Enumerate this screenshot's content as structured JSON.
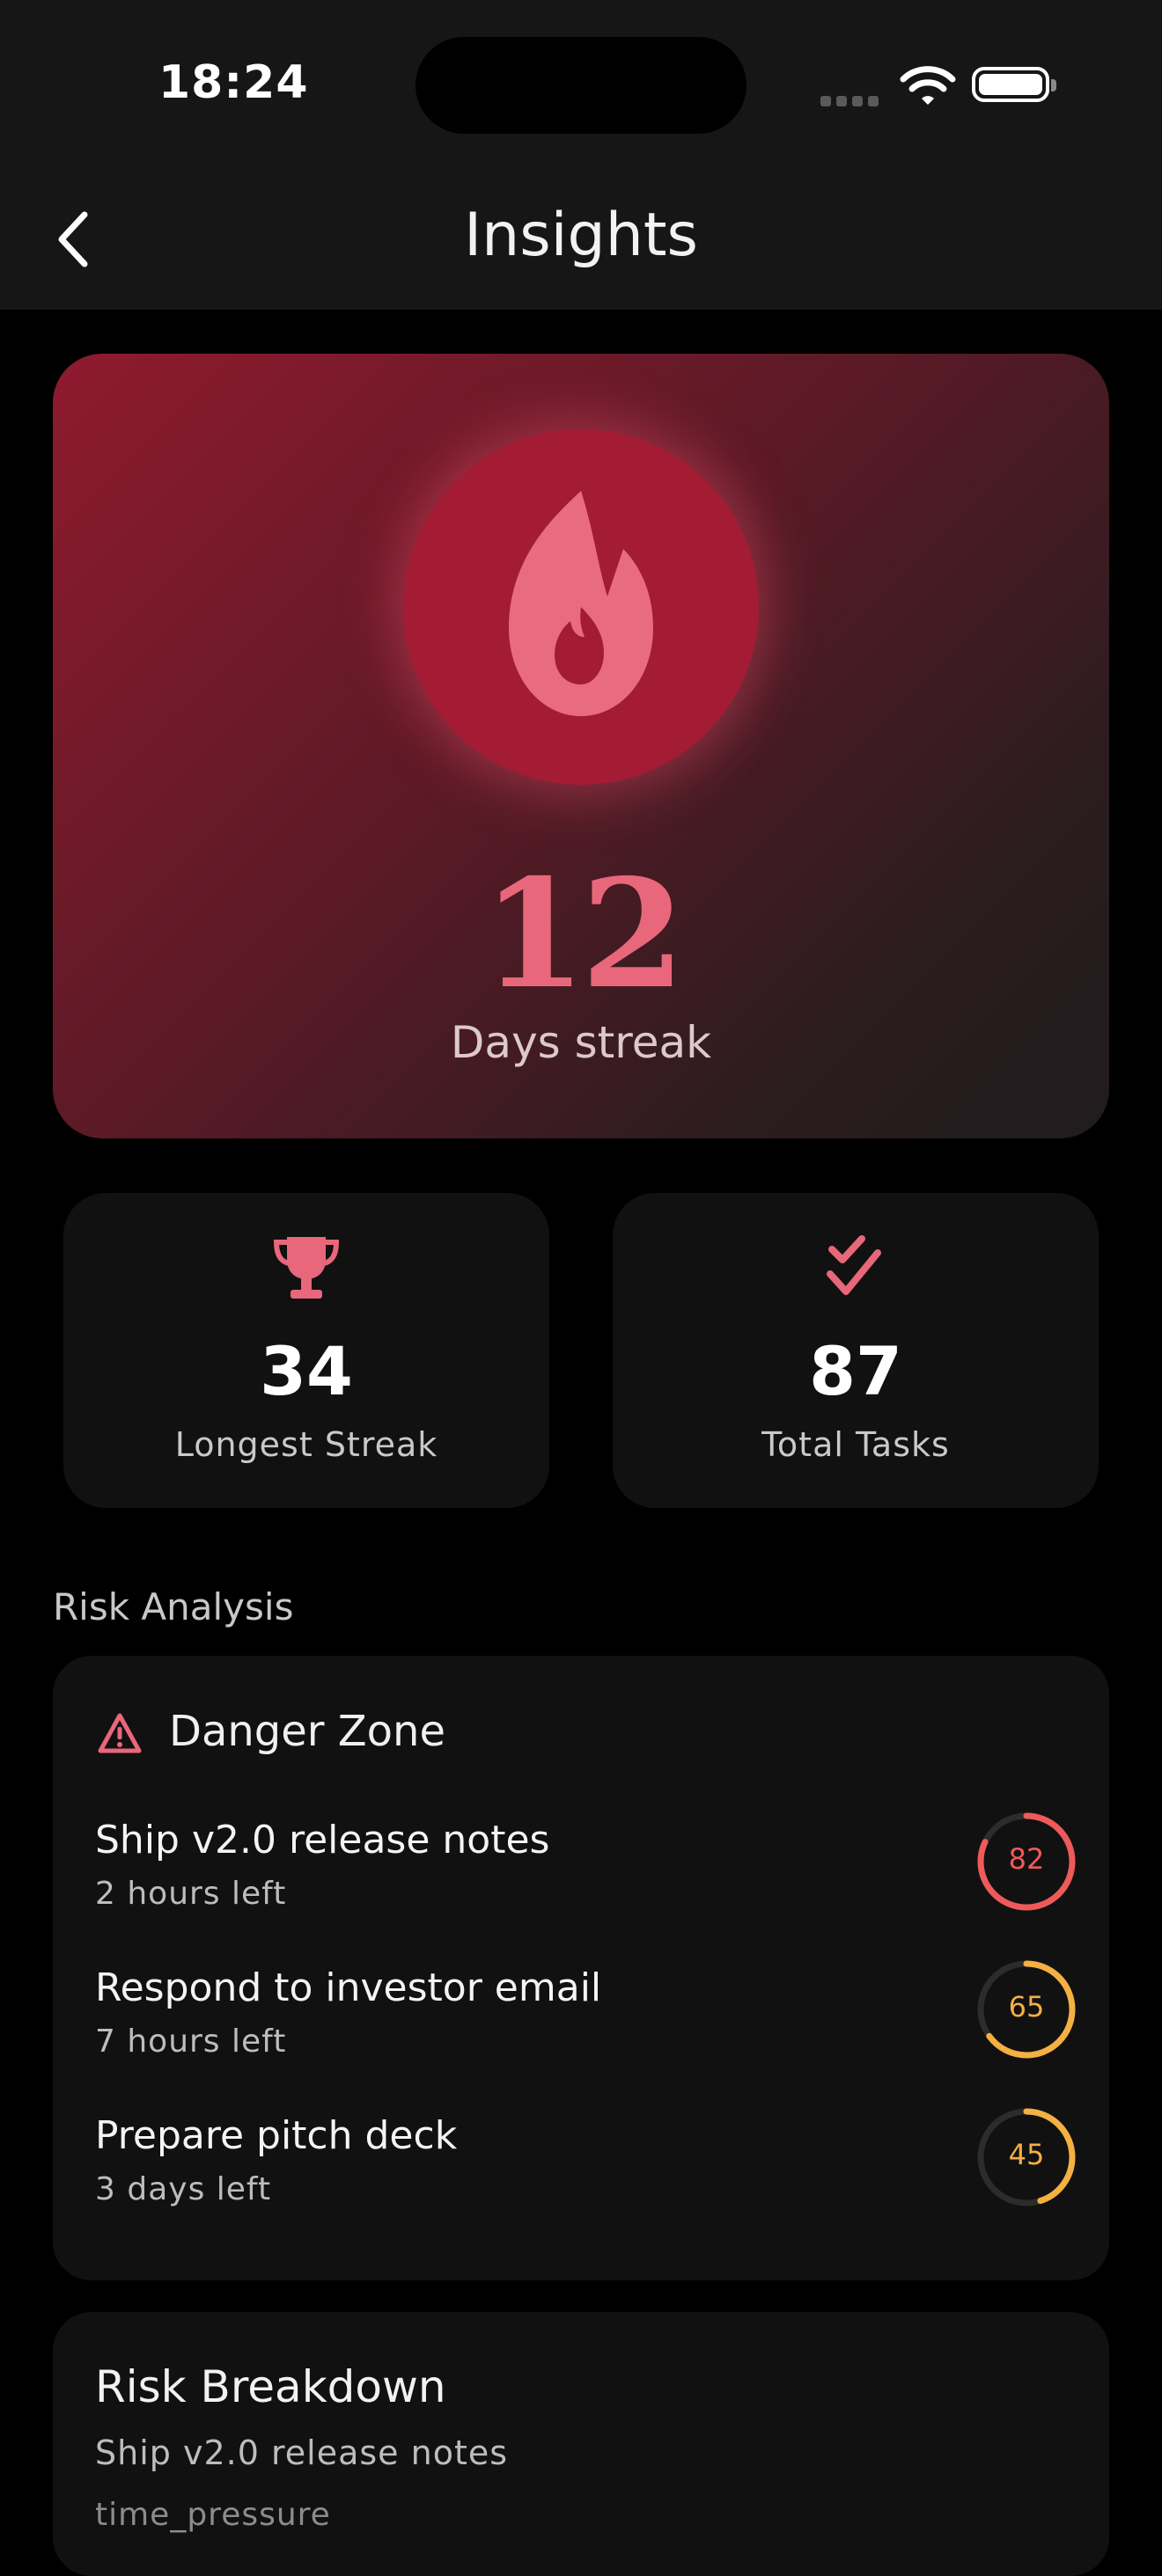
{
  "status_bar": {
    "time": "18:24",
    "icons": [
      "signal-icon",
      "wifi-icon",
      "battery-icon"
    ]
  },
  "nav": {
    "title": "Insights",
    "back_icon": "chevron-left-icon"
  },
  "streak": {
    "icon": "flame-icon",
    "value": "12",
    "label": "Days streak"
  },
  "stats": [
    {
      "icon": "trophy-icon",
      "value": "34",
      "label": "Longest Streak"
    },
    {
      "icon": "double-check-icon",
      "value": "87",
      "label": "Total Tasks"
    }
  ],
  "risk_analysis": {
    "section_title": "Risk Analysis",
    "card_title": "Danger Zone",
    "card_icon": "warning-triangle-icon",
    "items": [
      {
        "name": "Ship v2.0 release notes",
        "time_left": "2 hours left",
        "score": "82",
        "score_fraction": 0.82,
        "color": "#ee5a5a"
      },
      {
        "name": "Respond to investor email",
        "time_left": "7 hours left",
        "score": "65",
        "score_fraction": 0.65,
        "color": "#f5b042"
      },
      {
        "name": "Prepare pitch deck",
        "time_left": "3 days left",
        "score": "45",
        "score_fraction": 0.45,
        "color": "#f5b042"
      }
    ]
  },
  "risk_breakdown": {
    "title": "Risk Breakdown",
    "task": "Ship v2.0 release notes",
    "factor": "time_pressure"
  },
  "colors": {
    "accent": "#e8677a",
    "danger": "#ee5a5a",
    "warning": "#f5b042",
    "card_bg": "#121112"
  }
}
